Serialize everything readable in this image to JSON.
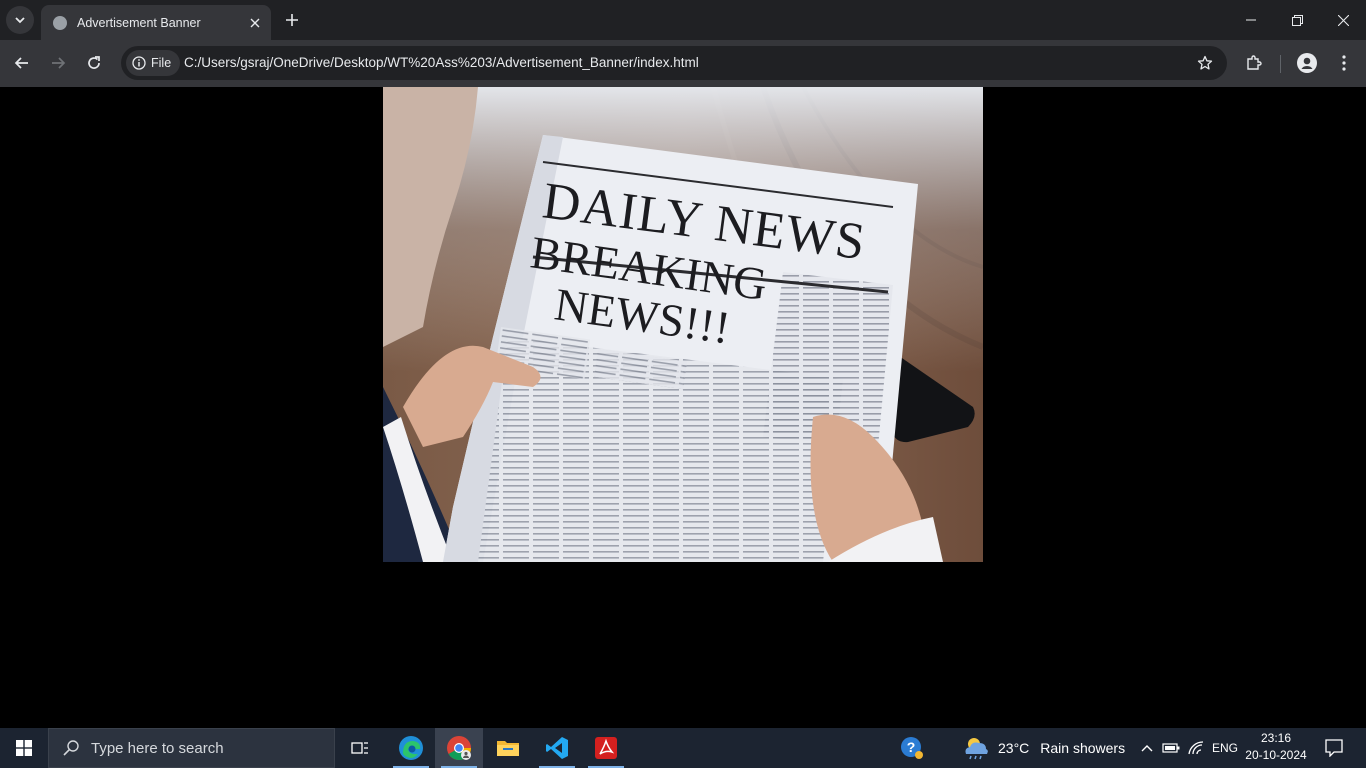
{
  "browser": {
    "tab_title": "Advertisement Banner",
    "chip_label": "File",
    "url": "C:/Users/gsraj/OneDrive/Desktop/WT%20Ass%203/Advertisement_Banner/index.html"
  },
  "banner": {
    "masthead": "DAILY NEWS",
    "headline_line1": "BREAKING",
    "headline_line2": "NEWS!!!"
  },
  "taskbar": {
    "search_placeholder": "Type here to search",
    "weather_temp": "23°C",
    "weather_text": "Rain showers",
    "language": "ENG",
    "time": "23:16",
    "date": "20-10-2024"
  },
  "colors": {
    "titlebar": "#202124",
    "toolbar": "#35363a",
    "taskbar": "#1c2431",
    "page_background": "#000000"
  }
}
